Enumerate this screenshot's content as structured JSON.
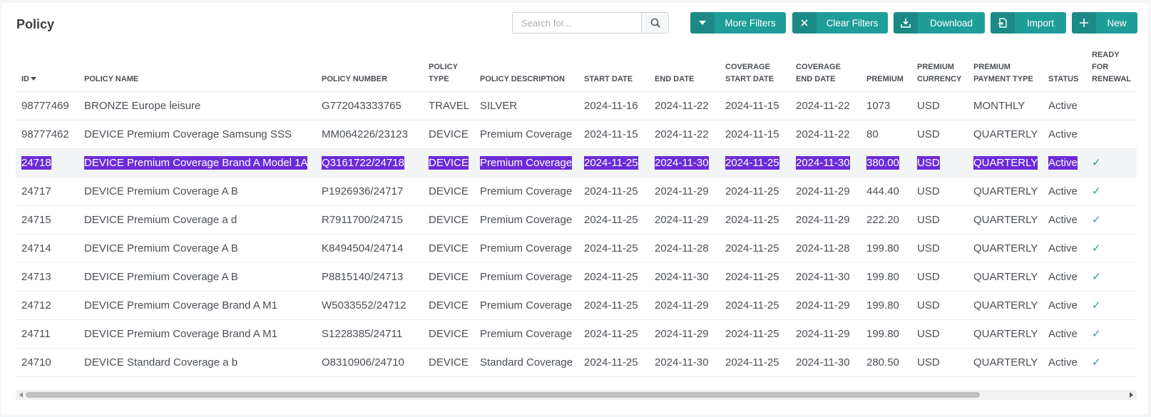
{
  "page": {
    "title": "Policy"
  },
  "search": {
    "placeholder": "Search for..."
  },
  "toolbar": {
    "more_filters": "More Filters",
    "clear_filters": "Clear Filters",
    "download": "Download",
    "import": "Import",
    "new": "New"
  },
  "table": {
    "headers": [
      "ID",
      "POLICY NAME",
      "POLICY NUMBER",
      "POLICY TYPE",
      "POLICY DESCRIPTION",
      "START DATE",
      "END DATE",
      "COVERAGE START DATE",
      "COVERAGE END DATE",
      "PREMIUM",
      "PREMIUM CURRENCY",
      "PREMIUM PAYMENT TYPE",
      "STATUS",
      "READY FOR RENEWAL"
    ],
    "rows": [
      [
        "98777469",
        "BRONZE Europe leisure",
        "G772043333765",
        "TRAVEL",
        "SILVER",
        "2024-11-16",
        "2024-11-22",
        "2024-11-15",
        "2024-11-22",
        "1073",
        "USD",
        "MONTHLY",
        "Active",
        ""
      ],
      [
        "98777462",
        "DEVICE Premium Coverage Samsung SSS",
        "MM064226/23123",
        "DEVICE",
        "Premium Coverage",
        "2024-11-15",
        "2024-11-22",
        "2024-11-15",
        "2024-11-22",
        "80",
        "USD",
        "QUARTERLY",
        "Active",
        ""
      ],
      [
        "24718",
        "DEVICE Premium Coverage Brand A Model 1A",
        "Q3161722/24718",
        "DEVICE",
        "Premium Coverage",
        "2024-11-25",
        "2024-11-30",
        "2024-11-25",
        "2024-11-30",
        "380.00",
        "USD",
        "QUARTERLY",
        "Active",
        "✓"
      ],
      [
        "24717",
        "DEVICE Premium Coverage A B",
        "P1926936/24717",
        "DEVICE",
        "Premium Coverage",
        "2024-11-25",
        "2024-11-29",
        "2024-11-25",
        "2024-11-29",
        "444.40",
        "USD",
        "QUARTERLY",
        "Active",
        "✓"
      ],
      [
        "24715",
        "DEVICE Premium Coverage a d",
        "R7911700/24715",
        "DEVICE",
        "Premium Coverage",
        "2024-11-25",
        "2024-11-29",
        "2024-11-25",
        "2024-11-29",
        "222.20",
        "USD",
        "QUARTERLY",
        "Active",
        "✓"
      ],
      [
        "24714",
        "DEVICE Premium Coverage A B",
        "K8494504/24714",
        "DEVICE",
        "Premium Coverage",
        "2024-11-25",
        "2024-11-28",
        "2024-11-25",
        "2024-11-28",
        "199.80",
        "USD",
        "QUARTERLY",
        "Active",
        "✓"
      ],
      [
        "24713",
        "DEVICE Premium Coverage A B",
        "P8815140/24713",
        "DEVICE",
        "Premium Coverage",
        "2024-11-25",
        "2024-11-30",
        "2024-11-25",
        "2024-11-30",
        "199.80",
        "USD",
        "QUARTERLY",
        "Active",
        "✓"
      ],
      [
        "24712",
        "DEVICE Premium Coverage Brand A M1",
        "W5033552/24712",
        "DEVICE",
        "Premium Coverage",
        "2024-11-25",
        "2024-11-29",
        "2024-11-25",
        "2024-11-29",
        "199.80",
        "USD",
        "QUARTERLY",
        "Active",
        "✓"
      ],
      [
        "24711",
        "DEVICE Premium Coverage Brand A M1",
        "S1228385/24711",
        "DEVICE",
        "Premium Coverage",
        "2024-11-25",
        "2024-11-29",
        "2024-11-25",
        "2024-11-29",
        "199.80",
        "USD",
        "QUARTERLY",
        "Active",
        "✓"
      ],
      [
        "24710",
        "DEVICE Standard Coverage a b",
        "O8310906/24710",
        "DEVICE",
        "Standard Coverage",
        "2024-11-25",
        "2024-11-30",
        "2024-11-25",
        "2024-11-30",
        "280.50",
        "USD",
        "QUARTERLY",
        "Active",
        "✓"
      ]
    ],
    "selected_row": 2,
    "sorted_column": 0
  },
  "icons": {
    "search": "search-icon",
    "more_filters": "caret-down-icon",
    "clear_filters": "close-icon",
    "download": "download-icon",
    "import": "import-icon",
    "new": "plus-icon",
    "renewal": "check-icon"
  },
  "colors": {
    "accent": "#1f9e99",
    "selection": "#6b2bd9"
  }
}
